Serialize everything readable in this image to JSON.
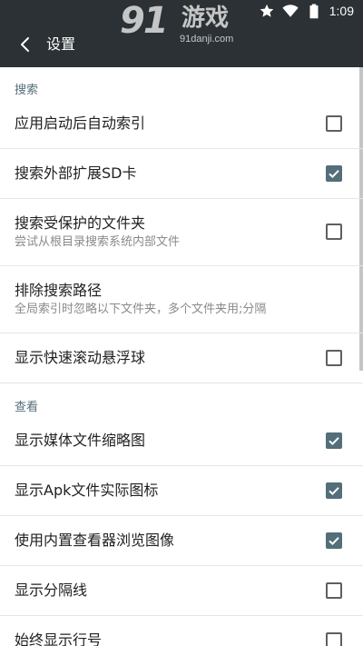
{
  "status_bar": {
    "time": "1:09",
    "icons": [
      "star-icon",
      "wifi-icon",
      "battery-icon"
    ]
  },
  "toolbar": {
    "title": "设置",
    "back_icon": "back-arrow-icon"
  },
  "watermark": {
    "logo_text": "91",
    "brand": "游戏",
    "url": "91danji.com"
  },
  "colors": {
    "toolbar": "#2b3134",
    "accent": "#546e7a",
    "category_text": "#546e7a",
    "summary_text": "#8a8a8a"
  },
  "sections": [
    {
      "header": "搜索",
      "items": [
        {
          "title": "应用启动后自动索引",
          "summary": "",
          "checkbox": true,
          "checked": false
        },
        {
          "title": "搜索外部扩展SD卡",
          "summary": "",
          "checkbox": true,
          "checked": true
        },
        {
          "title": "搜索受保护的文件夹",
          "summary": "尝试从根目录搜索系统内部文件",
          "checkbox": true,
          "checked": false
        },
        {
          "title": "排除搜索路径",
          "summary": "全局索引时忽略以下文件夹，多个文件夹用;分隔",
          "checkbox": false,
          "checked": false
        },
        {
          "title": "显示快速滚动悬浮球",
          "summary": "",
          "checkbox": true,
          "checked": false
        }
      ]
    },
    {
      "header": "查看",
      "items": [
        {
          "title": "显示媒体文件缩略图",
          "summary": "",
          "checkbox": true,
          "checked": true
        },
        {
          "title": "显示Apk文件实际图标",
          "summary": "",
          "checkbox": true,
          "checked": true
        },
        {
          "title": "使用内置查看器浏览图像",
          "summary": "",
          "checkbox": true,
          "checked": true
        },
        {
          "title": "显示分隔线",
          "summary": "",
          "checkbox": true,
          "checked": false
        },
        {
          "title": "始终显示行号",
          "summary": "",
          "checkbox": true,
          "checked": false
        }
      ]
    }
  ]
}
